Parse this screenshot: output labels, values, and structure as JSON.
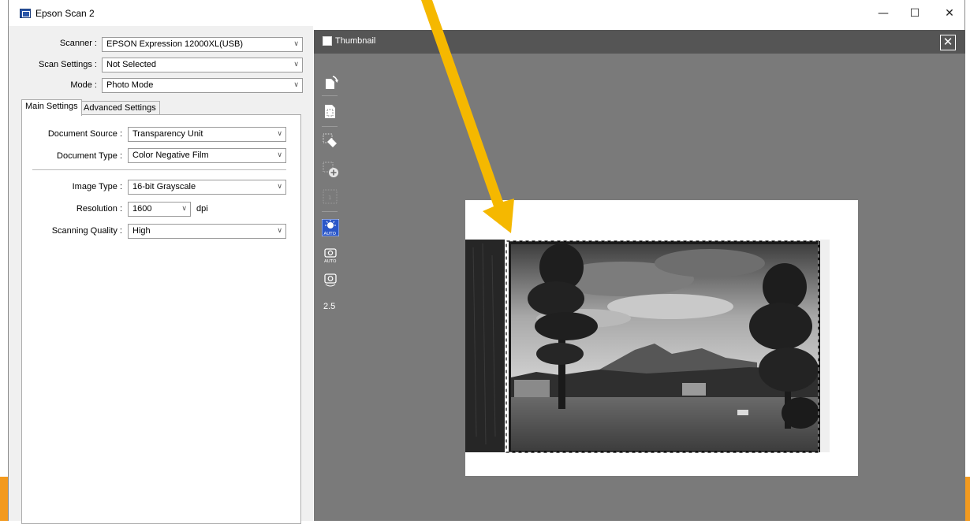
{
  "window": {
    "title": "Epson Scan 2",
    "minimize": "—",
    "maximize": "☐",
    "close": "✕"
  },
  "settings": {
    "scanner": {
      "label": "Scanner :",
      "value": "EPSON Expression 12000XL(USB)"
    },
    "scan_settings": {
      "label": "Scan Settings :",
      "value": "Not Selected"
    },
    "mode": {
      "label": "Mode :",
      "value": "Photo Mode"
    }
  },
  "tabs": {
    "main": "Main Settings",
    "advanced": "Advanced Settings"
  },
  "main_settings": {
    "document_source": {
      "label": "Document Source :",
      "value": "Transparency Unit"
    },
    "document_type": {
      "label": "Document Type :",
      "value": "Color Negative Film"
    },
    "image_type": {
      "label": "Image Type :",
      "value": "16-bit Grayscale"
    },
    "resolution": {
      "label": "Resolution :",
      "value": "1600",
      "unit": "dpi"
    },
    "scanning_quality": {
      "label": "Scanning Quality :",
      "value": "High"
    }
  },
  "preview": {
    "thumbnail_label": "Thumbnail",
    "zoom_value": "2.5",
    "tools": [
      "rotate-icon",
      "select-all-icon",
      "erase-marquee-icon",
      "add-marquee-icon",
      "marquee-number-icon",
      "auto-exposure-icon",
      "auto-photo-icon",
      "photo-adjust-icon"
    ],
    "auto_badge": "AUTO"
  },
  "colors": {
    "accent_arrow": "#f5b800",
    "preview_bg": "#7a7a7a",
    "toolbar_bg": "#555555",
    "backdrop": "#f39a1e"
  }
}
